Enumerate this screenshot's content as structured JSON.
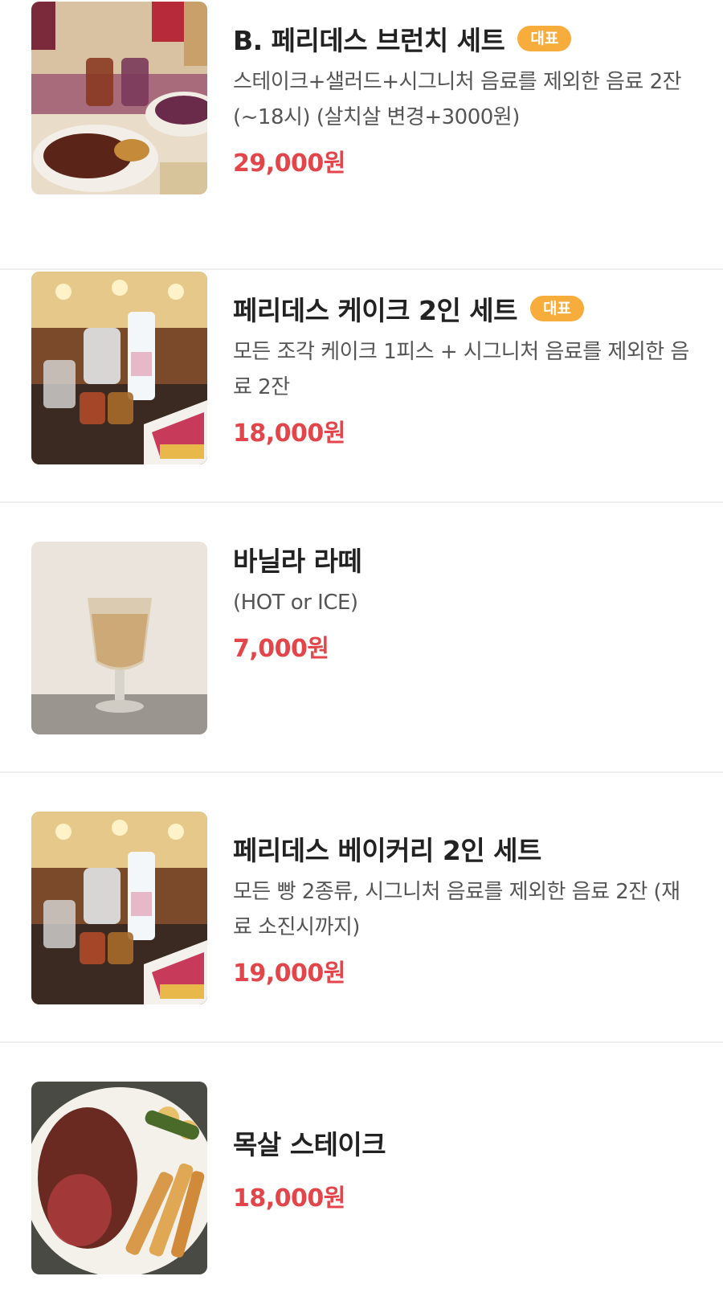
{
  "menu": {
    "items": [
      {
        "title": "B. 페리데스 브런치 세트",
        "badge": "대표",
        "description": "스테이크+샐러드+시그니처 음료를 제외한 음료 2잔 (~18시) (살치살 변경+3000원)",
        "price": "29,000원",
        "image": "brunch-steak-photo"
      },
      {
        "title": "페리데스 케이크 2인 세트",
        "badge": "대표",
        "description": "모든 조각 케이크 1피스 + 시그니처 음료를 제외한 음료 2잔",
        "price": "18,000원",
        "image": "cake-set-photo"
      },
      {
        "title": "바닐라 라떼",
        "badge": "",
        "description": "(HOT or ICE)",
        "price": "7,000원",
        "image": "vanilla-latte-photo"
      },
      {
        "title": "페리데스 베이커리 2인 세트",
        "badge": "",
        "description": "모든 빵 2종류, 시그니처 음료를 제외한 음료 2잔 (재료 소진시까지)",
        "price": "19,000원",
        "image": "bakery-set-photo"
      },
      {
        "title": "목살 스테이크",
        "badge": "",
        "description": "",
        "price": "18,000원",
        "image": "pork-neck-steak-photo"
      }
    ]
  },
  "colors": {
    "price": "#e2464b",
    "badge": "#f7ad3c",
    "divider": "#f0f0f0"
  }
}
